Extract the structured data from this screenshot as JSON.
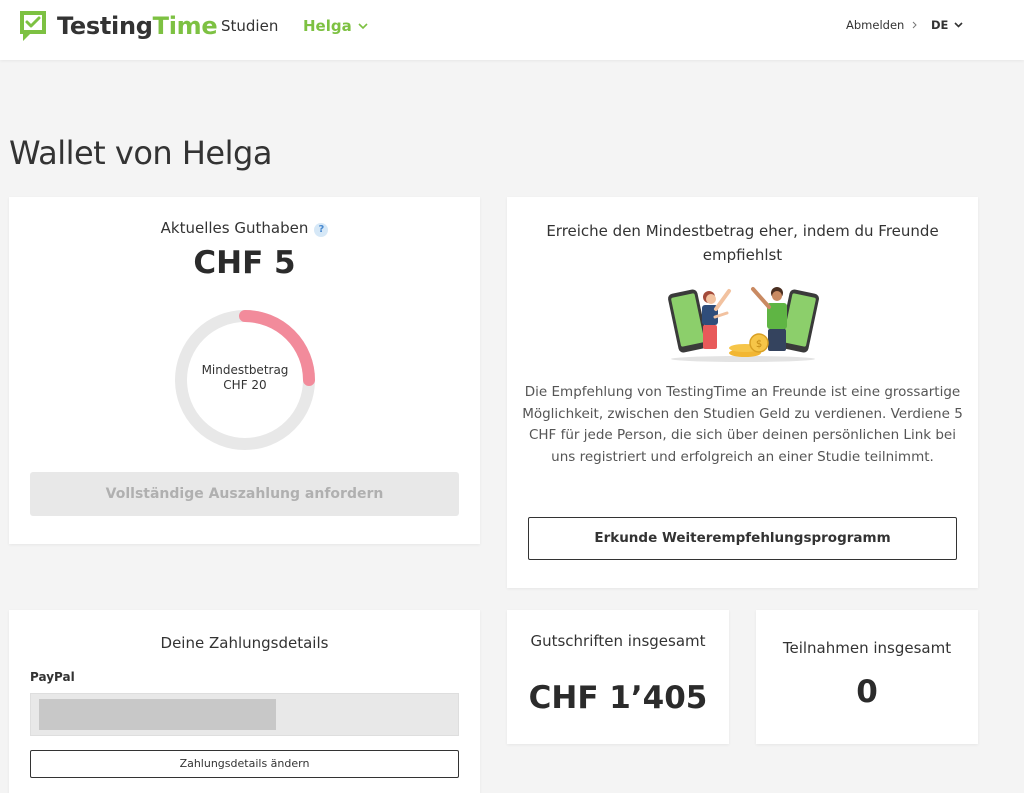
{
  "header": {
    "logo_text_1": "Testing",
    "logo_text_2": "Time",
    "nav_studien": "Studien",
    "nav_user": "Helga",
    "logout": "Abmelden",
    "language": "DE"
  },
  "page": {
    "title": "Wallet von Helga"
  },
  "balance": {
    "label": "Aktuelles Guthaben",
    "help": "?",
    "amount": "CHF 5",
    "minimum_label": "Mindestbetrag",
    "minimum_amount": "CHF 20",
    "progress_fraction": 0.25,
    "progress_color": "#f28b9b",
    "track_color": "#e8e8e8",
    "payout_button": "Vollständige Auszahlung anfordern"
  },
  "referral": {
    "title": "Erreiche den Mindestbetrag eher, indem du Freunde empfiehlst",
    "text": "Die Empfehlung von TestingTime an Freunde ist eine grossartige Möglichkeit, zwischen den Studien Geld zu verdienen. Verdiene 5 CHF für jede Person, die sich über deinen persönlichen Link bei uns registriert und erfolgreich an einer Studie teilnimmt.",
    "button": "Erkunde Weiterempfehlungsprogramm"
  },
  "payment": {
    "title": "Deine Zahlungsdetails",
    "method": "PayPal",
    "change_button": "Zahlungsdetails ändern"
  },
  "stats": {
    "credits_label": "Gutschriften insgesamt",
    "credits_value": "CHF 1’405",
    "participations_label": "Teilnahmen insgesamt",
    "participations_value": "0"
  },
  "colors": {
    "brand_green": "#7dc142",
    "background": "#f4f4f4"
  }
}
